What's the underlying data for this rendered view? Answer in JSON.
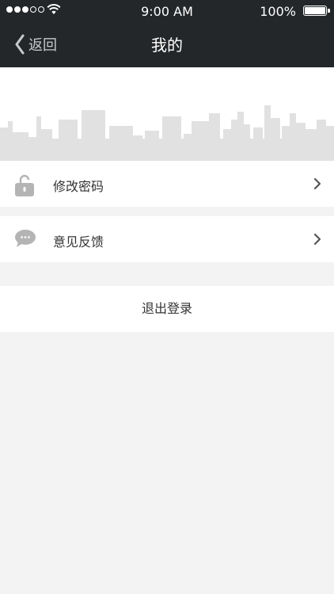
{
  "status_bar": {
    "time": "9:00 AM",
    "battery": "100%",
    "battery_level": 1.0,
    "signal_strength": 3,
    "signal_max": 5
  },
  "nav": {
    "back_label": "返回",
    "title": "我的"
  },
  "menu": [
    {
      "label": "修改密码",
      "icon": "lock-icon"
    },
    {
      "label": "意见反馈",
      "icon": "chat-bubble-icon"
    }
  ],
  "logout_label": "退出登录",
  "colors": {
    "header_bg": "#24272a",
    "page_bg": "#f3f3f3",
    "skyline": "#e1e1e1",
    "icon_gray": "#b4b4b4"
  }
}
